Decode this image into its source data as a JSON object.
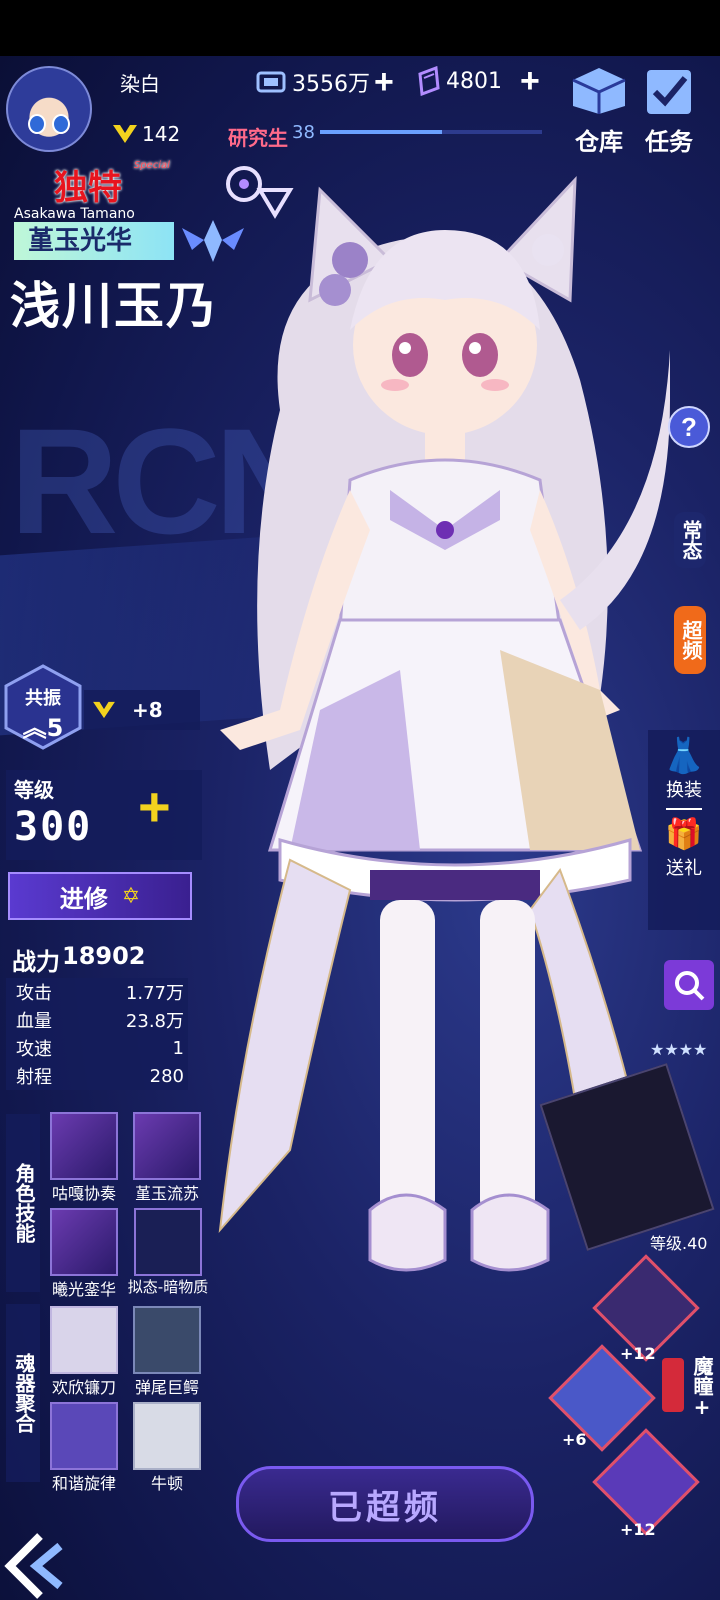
{
  "player": {
    "name": "染白",
    "rank_value": "142"
  },
  "currency": {
    "coins": "3556万",
    "gems": "4801"
  },
  "top_buttons": {
    "warehouse": "仓库",
    "tasks": "任务"
  },
  "research": {
    "label": "研究生",
    "level": "38",
    "progress": 0.55
  },
  "character": {
    "rarity": "独特",
    "rarity_sub": "Special",
    "romaji": "Asakawa Tamano",
    "title": "堇玉光华",
    "name": "浅川玉乃"
  },
  "resonance": {
    "label": "共振",
    "level": "5",
    "bonus": "+8"
  },
  "level": {
    "label": "等级",
    "value": "300"
  },
  "advance_button": "进修",
  "power": {
    "label": "战力",
    "value": "18902"
  },
  "stats": [
    {
      "name": "攻击",
      "value": "1.77万"
    },
    {
      "name": "血量",
      "value": "23.8万"
    },
    {
      "name": "攻速",
      "value": "1"
    },
    {
      "name": "射程",
      "value": "280"
    }
  ],
  "skills_section": {
    "label": "角色技能"
  },
  "skills": [
    "咕嘎协奏",
    "堇玉流苏",
    "曦光銮华",
    "拟态-暗物质"
  ],
  "soul_section": {
    "label": "魂器聚合"
  },
  "soul_weapons": [
    "欢欣镰刀",
    "弹尾巨鳄",
    "和谐旋律",
    "牛顿"
  ],
  "side_tabs": {
    "normal": "常态",
    "overclock": "超频"
  },
  "right_buttons": {
    "dress": "换装",
    "gift": "送礼"
  },
  "help": "?",
  "weapon_level": "等级.40",
  "equip": {
    "slot1": "+12",
    "slot2": "+6",
    "slot3": "+12",
    "eye_label": "魔瞳",
    "eye_plus": "+"
  },
  "overclocked_button": "已超频",
  "colors": {
    "accent": "#f6a21a",
    "purple": "#7d4cd8",
    "bg": "#141a4a"
  }
}
